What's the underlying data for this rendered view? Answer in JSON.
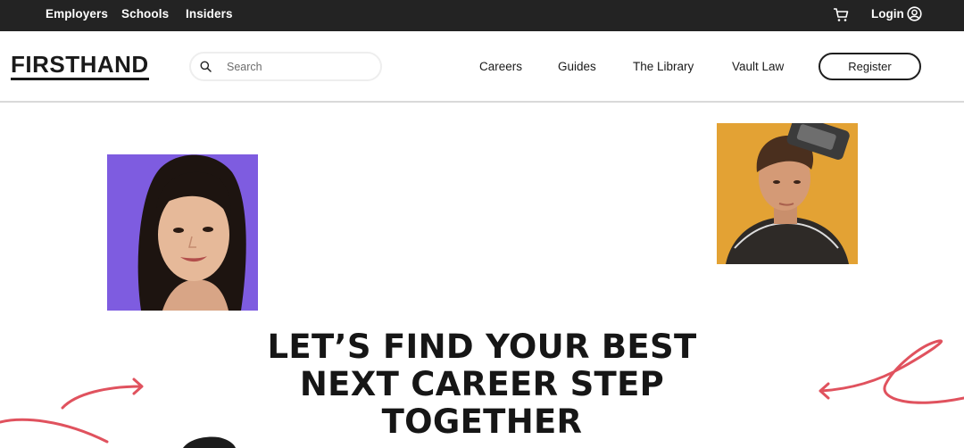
{
  "topbar": {
    "links": [
      "Employers",
      "Schools",
      "Insiders"
    ],
    "cart_icon": "cart-icon",
    "login_label": "Login",
    "user_icon": "user-circle-icon"
  },
  "header": {
    "logo": "FIRSTHAND",
    "search": {
      "placeholder": "Search",
      "icon": "search-icon"
    },
    "nav": [
      "Careers",
      "Guides",
      "The Library",
      "Vault Law"
    ],
    "register_label": "Register"
  },
  "hero": {
    "headline_lines": [
      "LET’S FIND YOUR BEST",
      "NEXT CAREER STEP",
      "TOGETHER"
    ]
  },
  "colors": {
    "topbar_bg": "#232323",
    "woman_photo_bg": "#7e5ce0",
    "man_photo_bg": "#e3a234",
    "accent_swirl": "#e0525e"
  }
}
